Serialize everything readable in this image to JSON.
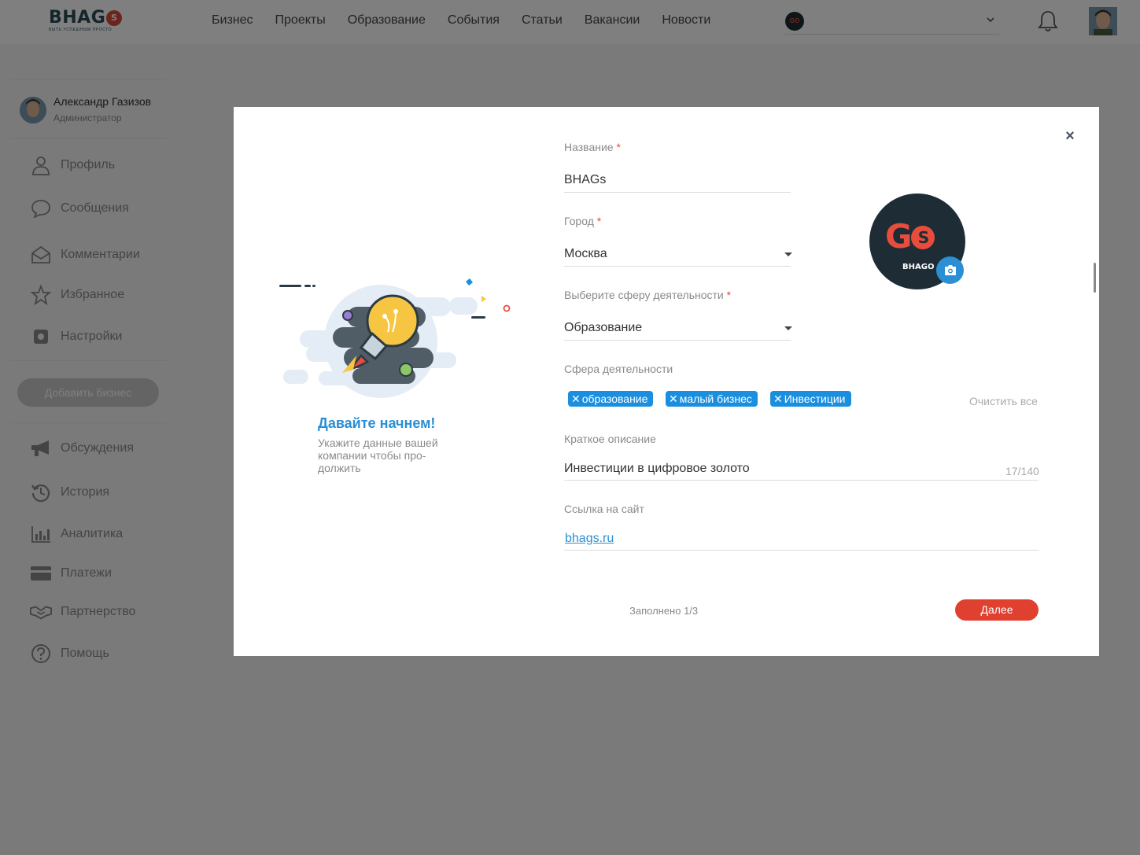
{
  "header": {
    "logo_text": "BHAGS",
    "logo_tagline": "БЫТЬ УСПЕШНЫМ ПРОСТО",
    "nav": [
      "Бизнес",
      "Проекты",
      "Образование",
      "События",
      "Статьи",
      "Вакансии",
      "Новости"
    ],
    "company_badge": "GO",
    "icons": {
      "bell": "bell-icon",
      "chevron": "chevron-down-icon"
    }
  },
  "sidebar": {
    "user_name": "Александр Газизов",
    "user_role": "Администратор",
    "items_top": [
      {
        "label": "Профиль",
        "icon": "user-icon"
      },
      {
        "label": "Сообщения",
        "icon": "chat-icon"
      },
      {
        "label": "Комментарии",
        "icon": "envelope-icon"
      },
      {
        "label": "Избранное",
        "icon": "star-icon"
      },
      {
        "label": "Настройки",
        "icon": "gear-icon"
      }
    ],
    "add_business": "Добавить бизнес",
    "items_bottom": [
      {
        "label": "Обсуждения",
        "icon": "megaphone-icon"
      },
      {
        "label": "История",
        "icon": "history-icon"
      },
      {
        "label": "Аналитика",
        "icon": "chart-icon"
      },
      {
        "label": "Платежи",
        "icon": "card-icon"
      },
      {
        "label": "Партнерство",
        "icon": "handshake-icon"
      },
      {
        "label": "Помощь",
        "icon": "help-icon"
      }
    ]
  },
  "modal": {
    "close": "×",
    "intro_title": "Давайте начнем!",
    "intro_text": "Укажите данные вашей компании чтобы про-должить",
    "name_label": "Название",
    "name_value": "BHAGs",
    "city_label": "Город",
    "city_value": "Москва",
    "sphere_select_label": "Выберите сферу деятельности",
    "sphere_select_value": "Образование",
    "sphere_label": "Сфера деятельности",
    "tags": [
      "образование",
      "малый бизнес",
      "Инвестиции"
    ],
    "clear_all": "Очистить все",
    "desc_label": "Краткое описание",
    "desc_value": "Инвестиции в цифровое золото",
    "desc_counter": "17/140",
    "site_label": "Ссылка на сайт",
    "site_value": "bhags.ru",
    "required_mark": "*",
    "logo_big": "GO",
    "logo_small": "BHAGO",
    "filled": "Заполнено 1/3",
    "next": "Далее",
    "colors": {
      "accent": "#2a8fd4",
      "brand_red": "#e0402f",
      "tag_blue": "#1a8fe0",
      "logo_bg": "#1e2d35"
    }
  }
}
